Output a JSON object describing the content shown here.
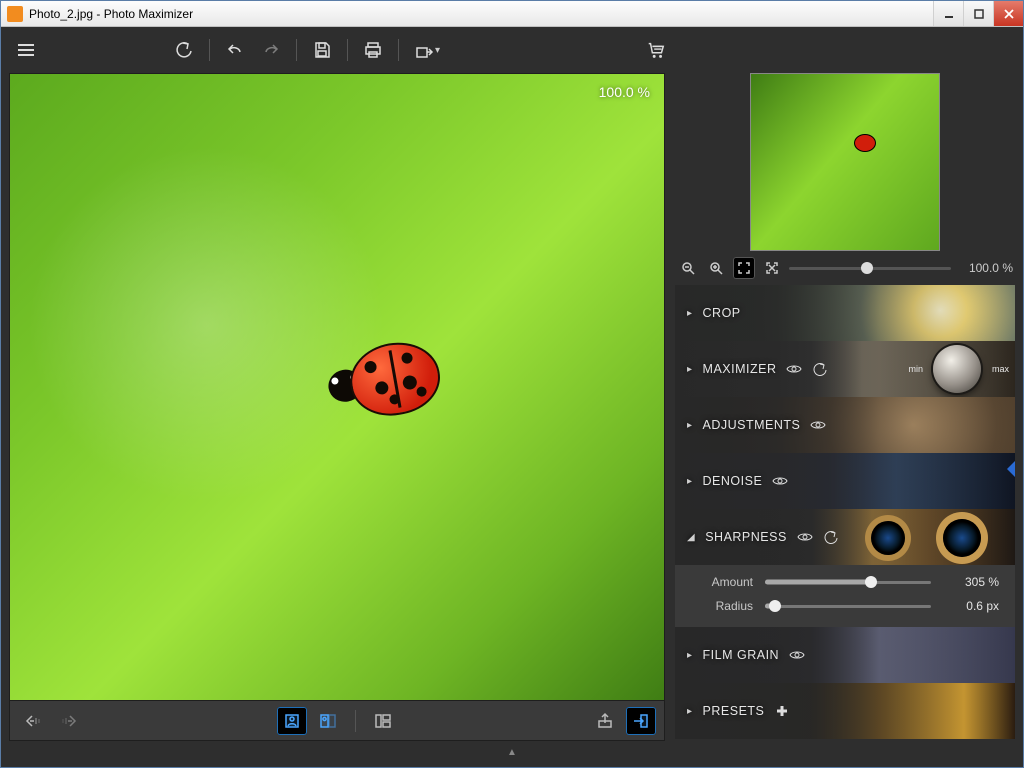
{
  "window": {
    "title": "Photo_2.jpg - Photo Maximizer"
  },
  "canvas": {
    "zoom_label": "100.0 %"
  },
  "navigator": {
    "zoom_value": "100.0 %",
    "slider_pos_pct": 48
  },
  "panels": {
    "crop": {
      "label": "CROP"
    },
    "maximizer": {
      "label": "MAXIMIZER",
      "min": "min",
      "max": "max"
    },
    "adjustments": {
      "label": "ADJUSTMENTS"
    },
    "denoise": {
      "label": "DENOISE"
    },
    "sharpness": {
      "label": "SHARPNESS",
      "amount": {
        "label": "Amount",
        "value": "305 %"
      },
      "radius": {
        "label": "Radius",
        "value": "0.6 px"
      }
    },
    "filmgrain": {
      "label": "FILM GRAIN"
    },
    "presets": {
      "label": "PRESETS"
    }
  }
}
